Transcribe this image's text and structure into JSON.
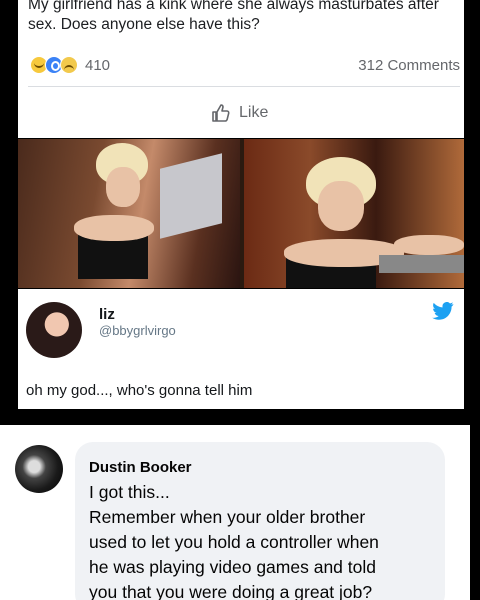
{
  "post": {
    "text": "My girlfriend has a kink where she always masturbates after sex. Does anyone else have this?",
    "reactions": [
      "haha-reaction",
      "wow-reaction",
      "sad-reaction"
    ],
    "reaction_count": "410",
    "comments_count": "312 Comments",
    "like_label": "Like"
  },
  "tweet": {
    "name": "liz",
    "handle": "@bbygrlvirgo",
    "text": "oh my god..., who's gonna tell him"
  },
  "comment": {
    "author": "Dustin Booker",
    "lines": [
      "I got this...",
      "Remember when your older brother",
      "used to let you hold a controller when",
      "he was playing video games and told",
      "you that you were doing a great job?"
    ]
  },
  "colors": {
    "facebook_gray": "#65676b",
    "twitter_blue": "#1da1f2",
    "bubble": "#f0f2f5"
  }
}
